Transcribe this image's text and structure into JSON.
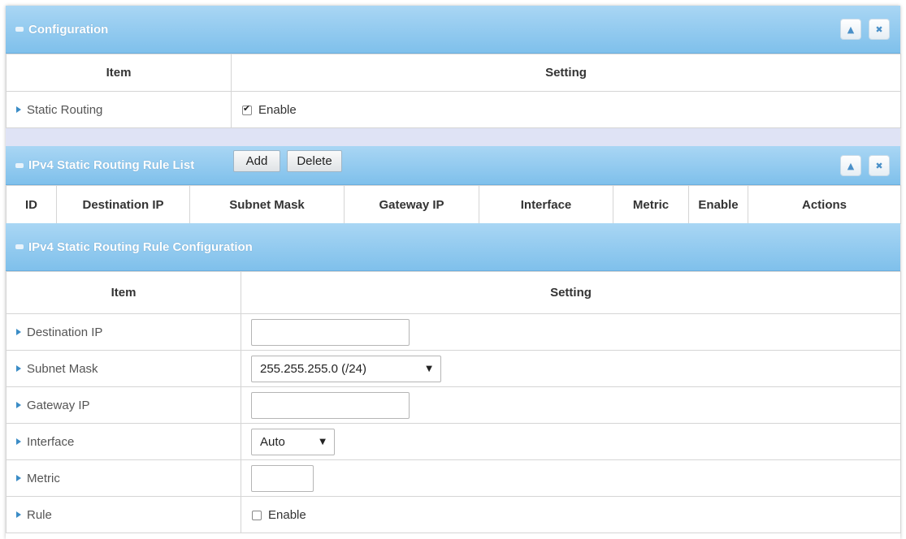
{
  "configuration": {
    "title": "Configuration",
    "columns": {
      "item": "Item",
      "setting": "Setting"
    },
    "static_routing": {
      "label": "Static Routing",
      "checkbox_label": "Enable",
      "checked": true
    }
  },
  "rule_list": {
    "title": "IPv4 Static Routing Rule List",
    "add_label": "Add",
    "delete_label": "Delete",
    "columns": [
      "ID",
      "Destination IP",
      "Subnet Mask",
      "Gateway IP",
      "Interface",
      "Metric",
      "Enable",
      "Actions"
    ]
  },
  "rule_config": {
    "title": "IPv4 Static Routing Rule Configuration",
    "columns": {
      "item": "Item",
      "setting": "Setting"
    },
    "fields": {
      "destination_ip": {
        "label": "Destination IP",
        "value": ""
      },
      "subnet_mask": {
        "label": "Subnet Mask",
        "value": "255.255.255.0 (/24)"
      },
      "gateway_ip": {
        "label": "Gateway IP",
        "value": ""
      },
      "interface": {
        "label": "Interface",
        "value": "Auto"
      },
      "metric": {
        "label": "Metric",
        "value": ""
      },
      "rule": {
        "label": "Rule",
        "checkbox_label": "Enable",
        "checked": false
      }
    }
  },
  "icons": {
    "collapse": "collapse-icon",
    "close": "close-icon",
    "expand": "triangle-right-icon"
  },
  "colors": {
    "header_bar": "#7fc0eb",
    "accent": "#3b8cc6",
    "band": "#dfe3f5"
  }
}
